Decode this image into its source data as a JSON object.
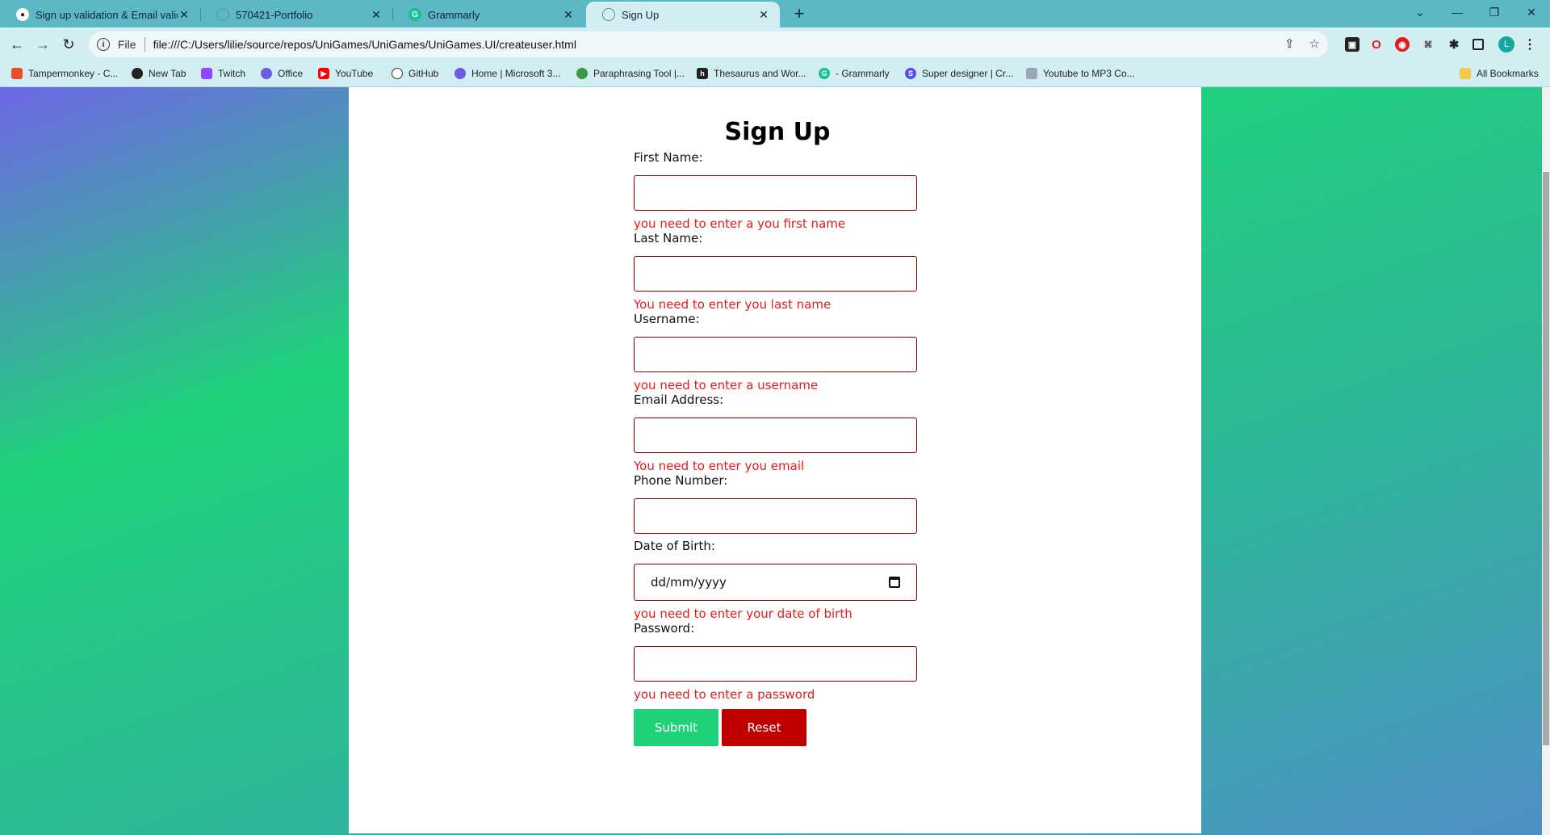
{
  "browser": {
    "tabs": [
      {
        "title": "Sign up validation & Email valid",
        "icon": "github-icon"
      },
      {
        "title": "570421-Portfolio",
        "icon": "globe-icon"
      },
      {
        "title": "Grammarly",
        "icon": "grammarly-icon"
      },
      {
        "title": "Sign Up",
        "icon": "globe-icon",
        "active": true
      }
    ],
    "close_glyph": "✕",
    "new_tab_glyph": "+",
    "address": {
      "scheme_label": "File",
      "url": "file:///C:/Users/lilie/source/repos/UniGames/UniGames/UniGames.UI/createuser.html"
    },
    "profile_initial": "L",
    "bookmarks": [
      {
        "label": "Tampermonkey - C...",
        "icon": "tampermonkey-icon",
        "color": "#e2522a"
      },
      {
        "label": "New Tab",
        "icon": "chrome-icon",
        "color": "#222222"
      },
      {
        "label": "Twitch",
        "icon": "twitch-icon",
        "color": "#9146ff"
      },
      {
        "label": "Office",
        "icon": "office-icon",
        "color": "#6b5ce7"
      },
      {
        "label": "YouTube",
        "icon": "youtube-icon",
        "color": "#ff0000"
      },
      {
        "label": "GitHub",
        "icon": "github-icon",
        "color": "#ffffff"
      },
      {
        "label": "Home | Microsoft 3...",
        "icon": "microsoft-icon",
        "color": "#6b5ce7"
      },
      {
        "label": "Paraphrasing Tool |...",
        "icon": "quillbot-icon",
        "color": "#3a9a46"
      },
      {
        "label": "Thesaurus and Wor...",
        "icon": "thesaurus-icon",
        "color": "#222222"
      },
      {
        "label": "- Grammarly",
        "icon": "grammarly-icon",
        "color": "#15c39a"
      },
      {
        "label": "Super designer | Cr...",
        "icon": "superdesigner-icon",
        "color": "#5b4de6"
      },
      {
        "label": "Youtube to MP3 Co...",
        "icon": "mp3-icon",
        "color": "#9aa7b8"
      }
    ],
    "all_bookmarks": "All Bookmarks"
  },
  "form": {
    "heading": "Sign Up",
    "first_name": {
      "label": "First Name:",
      "value": "",
      "error": "you need to enter a you first name"
    },
    "last_name": {
      "label": "Last Name:",
      "value": "",
      "error": "You need to enter you last name"
    },
    "username": {
      "label": "Username:",
      "value": "",
      "error": "you need to enter a username"
    },
    "email": {
      "label": "Email Address:",
      "value": "",
      "error": "You need to enter you email"
    },
    "phone": {
      "label": "Phone Number:",
      "value": ""
    },
    "dob": {
      "label": "Date of Birth:",
      "placeholder": "dd/mm/yyyy",
      "error": "you need to enter your date of birth"
    },
    "password": {
      "label": "Password:",
      "value": "",
      "error": "you need to enter a password"
    },
    "submit_label": "Submit",
    "reset_label": "Reset"
  },
  "colors": {
    "accent_green": "#1fd27a",
    "reset_red": "#c00000",
    "error_red": "#e31b1b",
    "field_border": "#8b0000"
  }
}
